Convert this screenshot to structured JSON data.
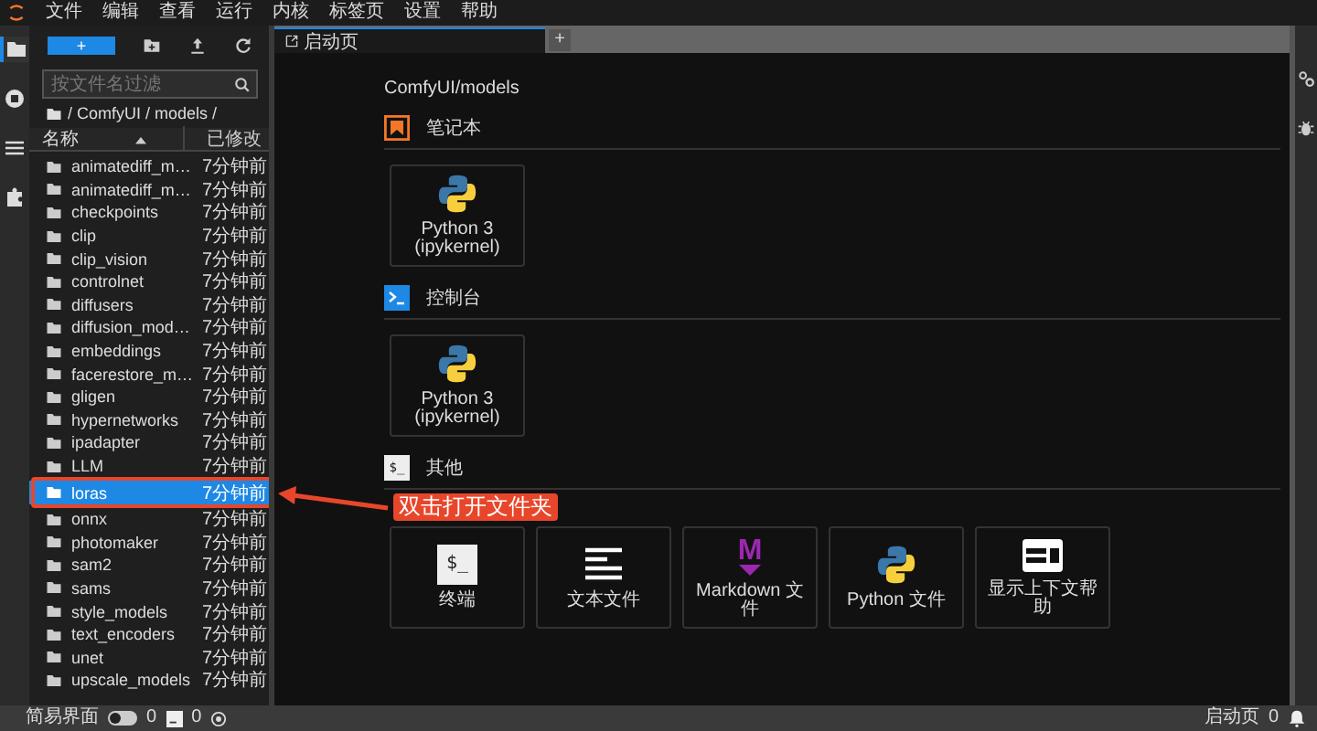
{
  "menu": [
    "文件",
    "编辑",
    "查看",
    "运行",
    "内核",
    "标签页",
    "设置",
    "帮助"
  ],
  "activity_bar": [
    {
      "kind": "folder",
      "selected": true
    },
    {
      "kind": "running",
      "selected": false
    },
    {
      "kind": "commands",
      "selected": false
    },
    {
      "kind": "extensions",
      "selected": false
    }
  ],
  "file_browser": {
    "new_button": "+",
    "filter": {
      "placeholder": "按文件名过滤"
    },
    "breadcrumb": "/ ComfyUI / models /",
    "columns": [
      "名称",
      "已修改"
    ],
    "rows": [
      {
        "name": "animatediff_m…",
        "modified": "7分钟前",
        "selected": false
      },
      {
        "name": "animatediff_m…",
        "modified": "7分钟前",
        "selected": false
      },
      {
        "name": "checkpoints",
        "modified": "7分钟前",
        "selected": false
      },
      {
        "name": "clip",
        "modified": "7分钟前",
        "selected": false
      },
      {
        "name": "clip_vision",
        "modified": "7分钟前",
        "selected": false
      },
      {
        "name": "controlnet",
        "modified": "7分钟前",
        "selected": false
      },
      {
        "name": "diffusers",
        "modified": "7分钟前",
        "selected": false
      },
      {
        "name": "diffusion_mod…",
        "modified": "7分钟前",
        "selected": false
      },
      {
        "name": "embeddings",
        "modified": "7分钟前",
        "selected": false
      },
      {
        "name": "facerestore_m…",
        "modified": "7分钟前",
        "selected": false
      },
      {
        "name": "gligen",
        "modified": "7分钟前",
        "selected": false
      },
      {
        "name": "hypernetworks",
        "modified": "7分钟前",
        "selected": false
      },
      {
        "name": "ipadapter",
        "modified": "7分钟前",
        "selected": false
      },
      {
        "name": "LLM",
        "modified": "7分钟前",
        "selected": false
      },
      {
        "name": "loras",
        "modified": "7分钟前",
        "selected": true
      },
      {
        "name": "onnx",
        "modified": "7分钟前",
        "selected": false
      },
      {
        "name": "photomaker",
        "modified": "7分钟前",
        "selected": false
      },
      {
        "name": "sam2",
        "modified": "7分钟前",
        "selected": false
      },
      {
        "name": "sams",
        "modified": "7分钟前",
        "selected": false
      },
      {
        "name": "style_models",
        "modified": "7分钟前",
        "selected": false
      },
      {
        "name": "text_encoders",
        "modified": "7分钟前",
        "selected": false
      },
      {
        "name": "unet",
        "modified": "7分钟前",
        "selected": false
      },
      {
        "name": "upscale_models",
        "modified": "7分钟前",
        "selected": false
      }
    ]
  },
  "tabs": [
    {
      "label": "启动页",
      "selected": true
    }
  ],
  "new_tab": "+",
  "launcher": {
    "path": "ComfyUI/models",
    "sections": [
      {
        "kind": "notebook",
        "title": "笔记本",
        "cards": [
          {
            "kind": "python",
            "label": "Python 3 (ipykernel)"
          }
        ]
      },
      {
        "kind": "console",
        "title": "控制台",
        "cards": [
          {
            "kind": "python",
            "label": "Python 3 (ipykernel)"
          }
        ]
      },
      {
        "kind": "other",
        "title": "其他",
        "icon_text": "$_",
        "cards": [
          {
            "kind": "terminal",
            "icon_text": "$_",
            "label": "终端"
          },
          {
            "kind": "text",
            "label": "文本文件"
          },
          {
            "kind": "markdown",
            "icon_text": "M",
            "label": "Markdown 文件"
          },
          {
            "kind": "python",
            "label": "Python 文件"
          },
          {
            "kind": "help",
            "label": "显示上下文帮助"
          }
        ]
      }
    ]
  },
  "annotation": {
    "text": "双击打开文件夹"
  },
  "status_bar": {
    "simple_mode": {
      "label": "简易界面",
      "on": false
    },
    "terminals": "0",
    "kernels": "0",
    "right_label": "启动页",
    "notifications": "0"
  }
}
